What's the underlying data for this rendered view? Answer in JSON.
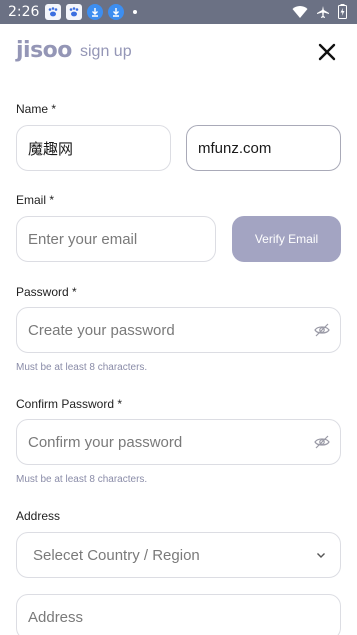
{
  "status_bar": {
    "time": "2:26",
    "icons": [
      "paw-icon",
      "paw-icon",
      "download-icon",
      "download-icon",
      "dot-icon",
      "wifi-icon",
      "airplane-icon",
      "battery-icon"
    ]
  },
  "header": {
    "logo": "jisoo",
    "subtitle": "sign up",
    "close_icon": "close-icon"
  },
  "form": {
    "name_label": "Name *",
    "first_name_value": "魔趣网",
    "last_name_value": "mfunz.com",
    "email_label": "Email *",
    "email_placeholder": "Enter your email",
    "verify_button": "Verify Email",
    "password_label": "Password *",
    "password_placeholder": "Create your password",
    "password_hint": "Must be at least 8 characters.",
    "confirm_label": "Confirm Password *",
    "confirm_placeholder": "Confirm your password",
    "confirm_hint": "Must be at least 8 characters.",
    "address_label": "Address",
    "country_placeholder": "Selecet Country / Region",
    "address_placeholder": "Address"
  },
  "colors": {
    "status_bar": "#6b7184",
    "brand": "#9496b6",
    "button": "#a3a4c2",
    "hint": "#8a8ca8"
  }
}
